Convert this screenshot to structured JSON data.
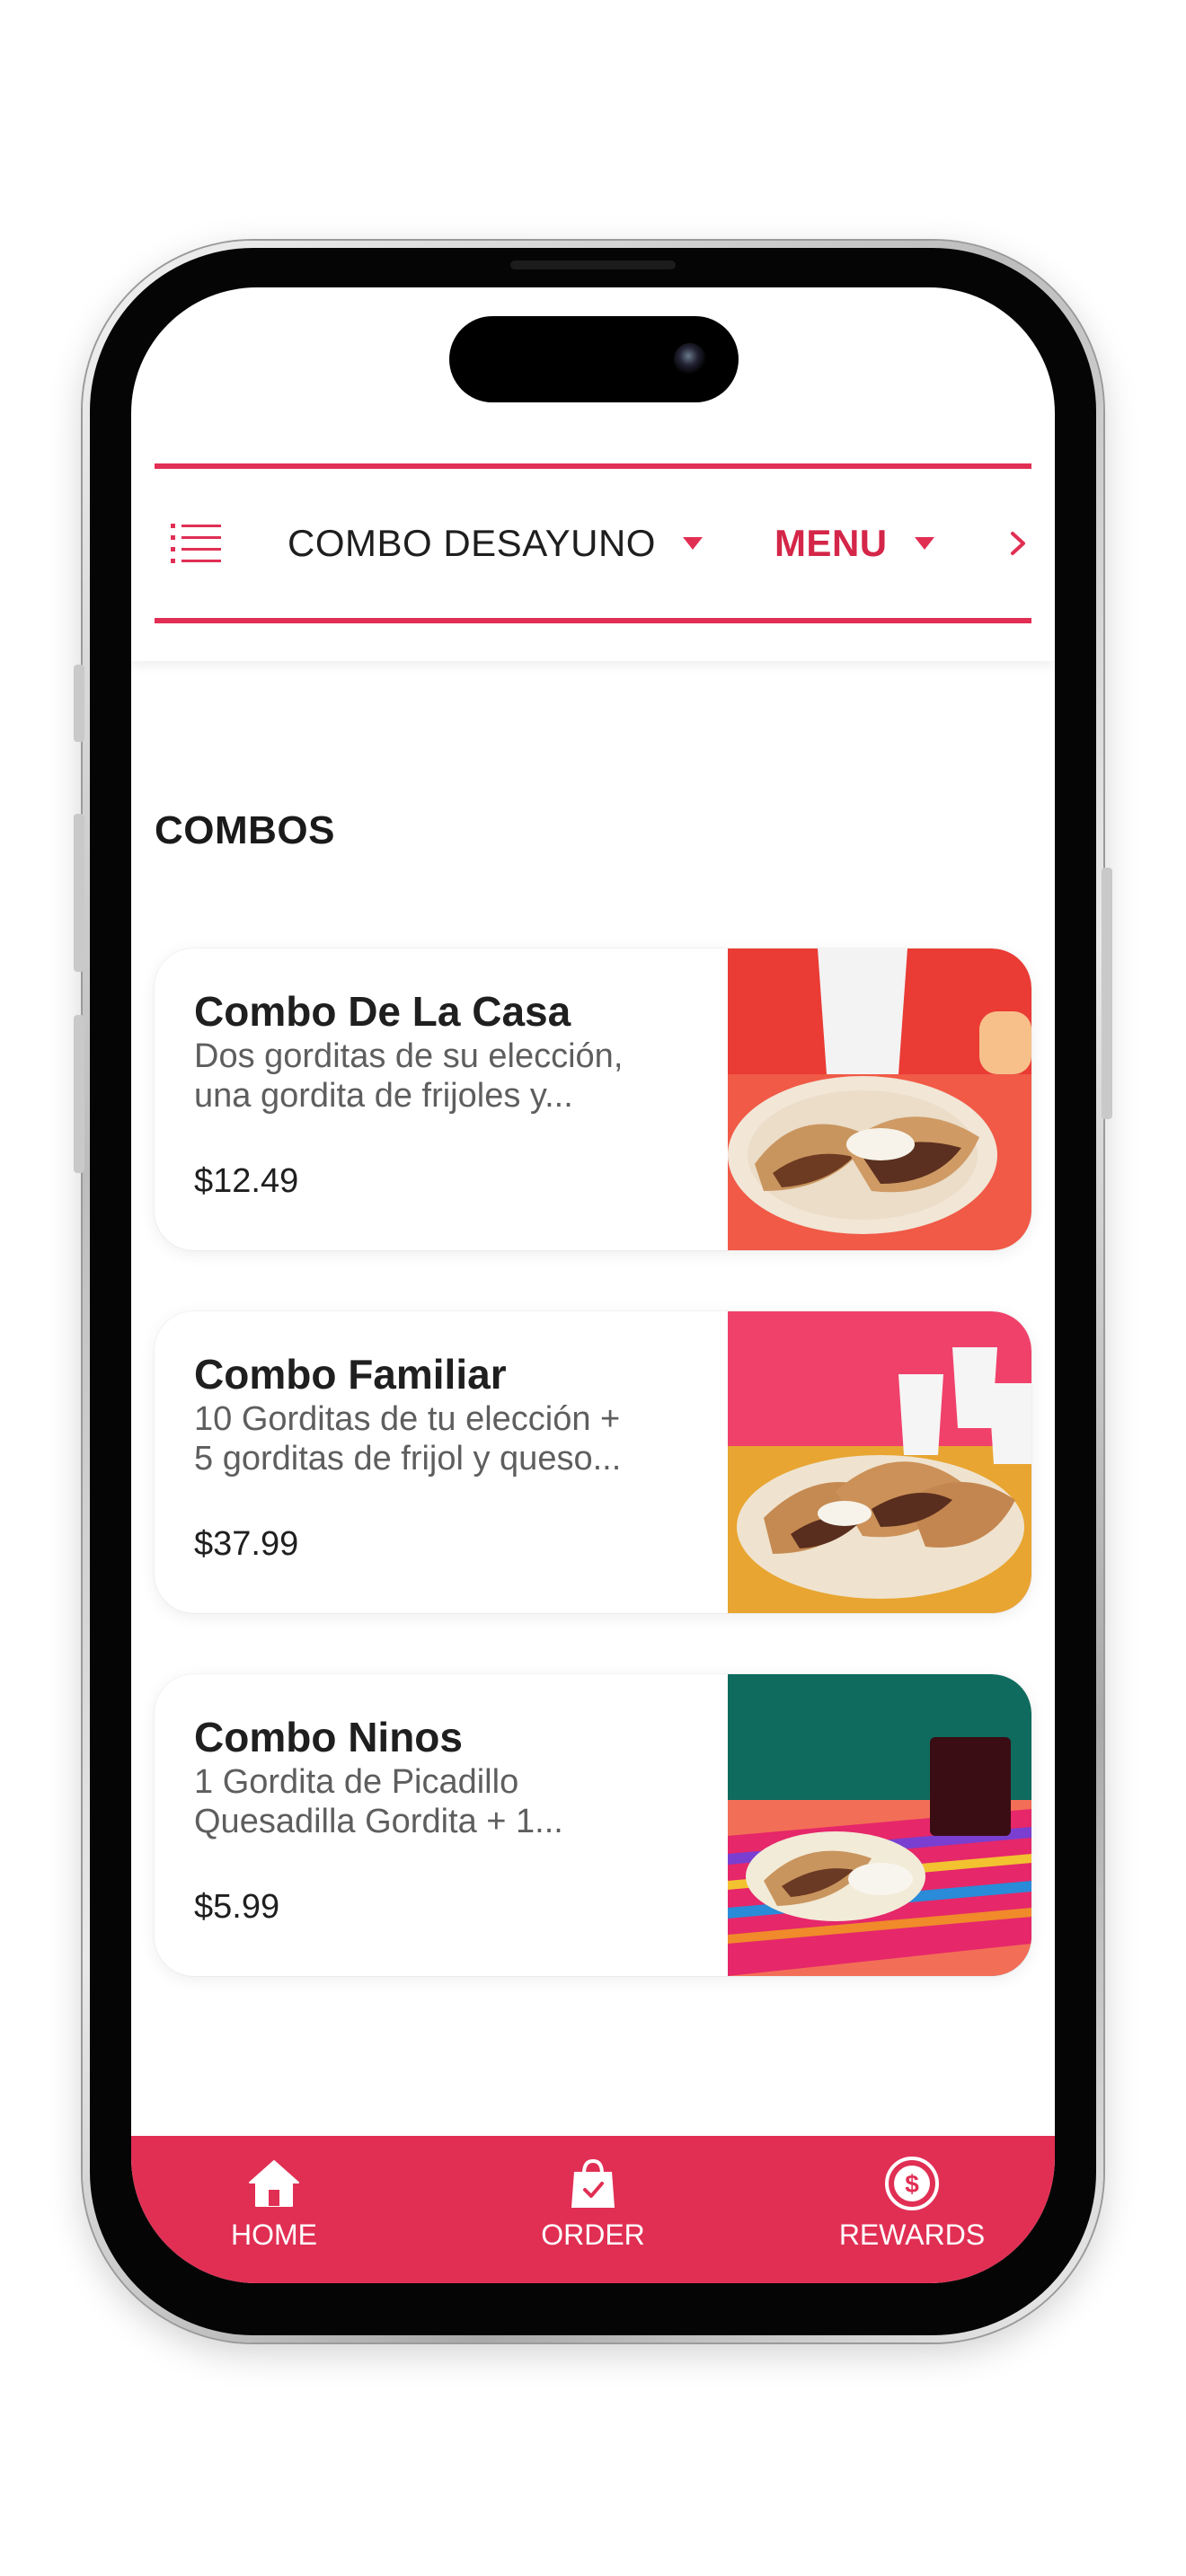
{
  "topbar": {
    "categories": [
      {
        "label": "COMBO DESAYUNO",
        "active": false
      },
      {
        "label": "MENU",
        "active": true
      }
    ],
    "menu_icon": "list-icon",
    "more_icon": "chevron-right-icon"
  },
  "section": {
    "title": "COMBOS"
  },
  "combos": [
    {
      "name": "Combo De La Casa",
      "description": "Dos gorditas de su elección,\nuna gordita de frijoles y...",
      "price": "$12.49"
    },
    {
      "name": "Combo Familiar",
      "description": "10 Gorditas de tu elección +\n5 gorditas de frijol y queso...",
      "price": "$37.99"
    },
    {
      "name": "Combo Ninos",
      "description": "1 Gordita de Picadillo\nQuesadilla Gordita + 1...",
      "price": "$5.99"
    }
  ],
  "bottom_nav": {
    "items": [
      {
        "label": "HOME",
        "icon": "home-icon"
      },
      {
        "label": "ORDER",
        "icon": "shopping-bag-icon"
      },
      {
        "label": "REWARDS",
        "icon": "dollar-badge-icon"
      }
    ]
  },
  "colors": {
    "accent": "#e12f54",
    "active_category": "#d42648",
    "text": "#1f1f1f",
    "muted": "#5e5e5e"
  }
}
